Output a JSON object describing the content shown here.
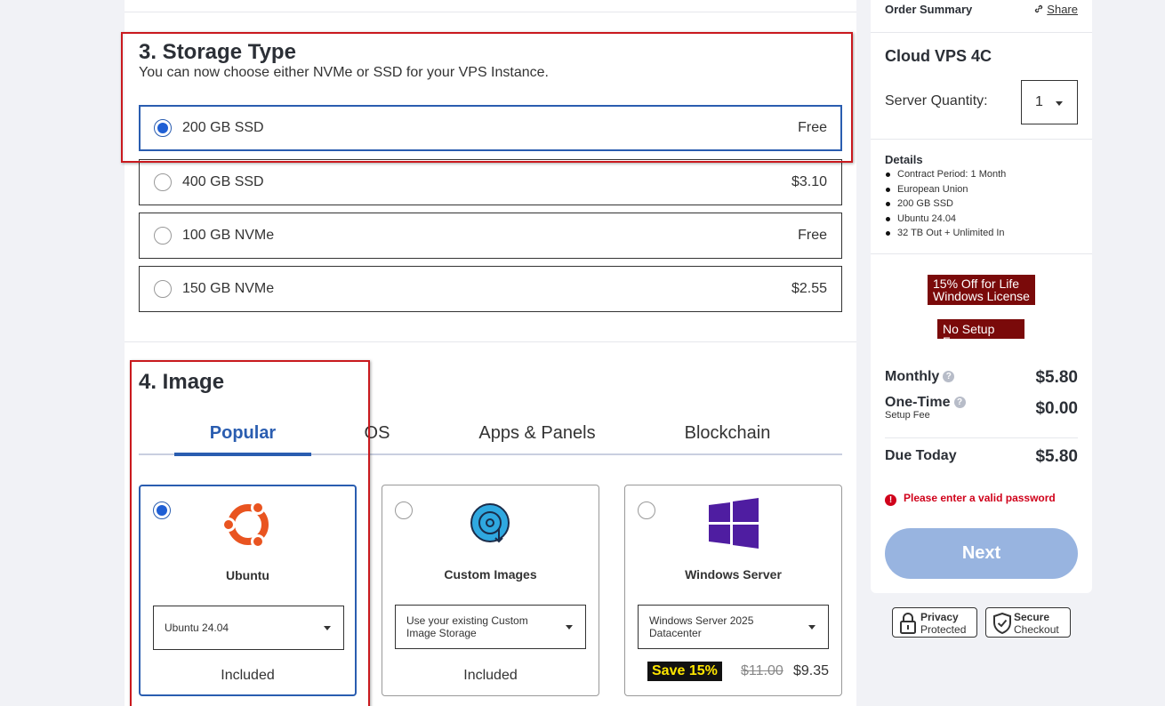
{
  "storage": {
    "title": "3. Storage Type",
    "subtitle": "You can now choose either NVMe or SSD for your VPS Instance.",
    "options": [
      {
        "label": "200 GB SSD",
        "price": "Free",
        "selected": true
      },
      {
        "label": "400 GB SSD",
        "price": "$3.10",
        "selected": false
      },
      {
        "label": "100 GB NVMe",
        "price": "Free",
        "selected": false
      },
      {
        "label": "150 GB NVMe",
        "price": "$2.55",
        "selected": false
      }
    ]
  },
  "image": {
    "title": "4. Image",
    "tabs": [
      "Popular",
      "OS",
      "Apps & Panels",
      "Blockchain"
    ],
    "active_tab": "Popular",
    "cards": [
      {
        "name": "Ubuntu",
        "icon": "ubuntu-icon",
        "select_value": "Ubuntu 24.04",
        "price": "Included",
        "selected": true
      },
      {
        "name": "Custom Images",
        "icon": "custom-image-icon",
        "select_value": "Use your existing Custom Image Storage",
        "price": "Included",
        "selected": false
      },
      {
        "name": "Windows Server",
        "icon": "windows-icon",
        "select_value": "Windows Server 2025 Datacenter",
        "save_label": "Save 15%",
        "old_price": "$11.00",
        "new_price": "$9.35",
        "selected": false
      }
    ]
  },
  "summary": {
    "title": "Order Summary",
    "share": "Share",
    "plan": "Cloud VPS 4C",
    "quantity_label": "Server Quantity:",
    "quantity": "1",
    "details_title": "Details",
    "details": [
      "Contract Period: 1 Month",
      "European Union",
      "200 GB SSD",
      "Ubuntu 24.04",
      "32 TB Out + Unlimited In"
    ],
    "promo1_line1": "15% Off for Life",
    "promo1_line2": "Windows License",
    "promo2": "No Setup Fee",
    "monthly_label": "Monthly",
    "monthly": "$5.80",
    "onetime_label": "One-Time",
    "onetime_sub": "Setup Fee",
    "onetime": "$0.00",
    "due_label": "Due Today",
    "due": "$5.80",
    "error": "Please enter a valid password",
    "next": "Next"
  },
  "badges": {
    "privacy_1": "Privacy",
    "privacy_2": "Protected",
    "secure_1": "Secure",
    "secure_2": "Checkout"
  },
  "colors": {
    "accent": "#2a5db0",
    "highlight": "#c9191e",
    "promo": "#7a0a0a",
    "error": "#d0021b"
  }
}
